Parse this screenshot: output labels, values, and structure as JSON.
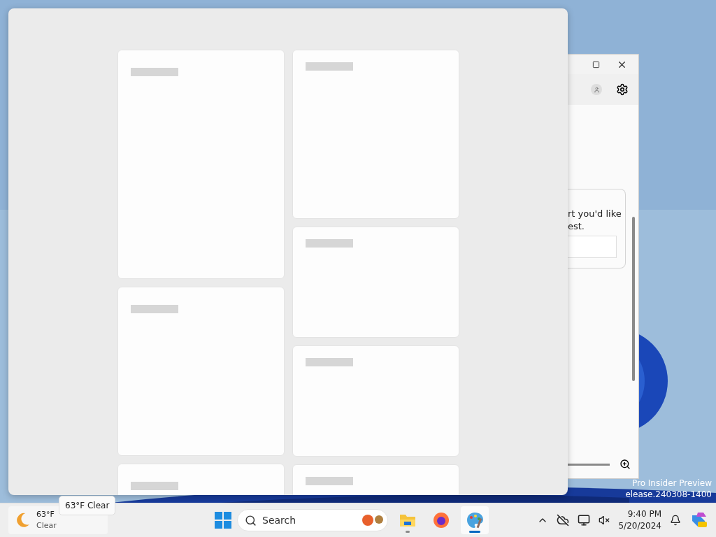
{
  "widgets_board": {
    "columns": [
      {
        "cards": [
          {
            "kind": "placeholder"
          },
          {
            "kind": "placeholder"
          },
          {
            "kind": "placeholder"
          }
        ]
      },
      {
        "cards": [
          {
            "kind": "placeholder"
          },
          {
            "kind": "placeholder"
          },
          {
            "kind": "placeholder"
          },
          {
            "kind": "placeholder"
          }
        ]
      }
    ]
  },
  "background_window": {
    "prompt_lines": [
      "rt you'd like",
      "est."
    ]
  },
  "watermark": {
    "line_1": "Pro Insider Preview",
    "line_2": "elease.240308-1400"
  },
  "tooltip": "63°F Clear",
  "taskbar": {
    "weather": {
      "temperature": "63°F",
      "condition": "Clear"
    },
    "search": {
      "placeholder": "Search"
    },
    "apps": [
      {
        "kind": "folder",
        "selected": false,
        "running": true
      },
      {
        "kind": "browser",
        "selected": false,
        "running": false
      },
      {
        "kind": "paint",
        "selected": true,
        "running": true
      }
    ],
    "time": "9:40 PM",
    "date": "5/20/2024"
  }
}
